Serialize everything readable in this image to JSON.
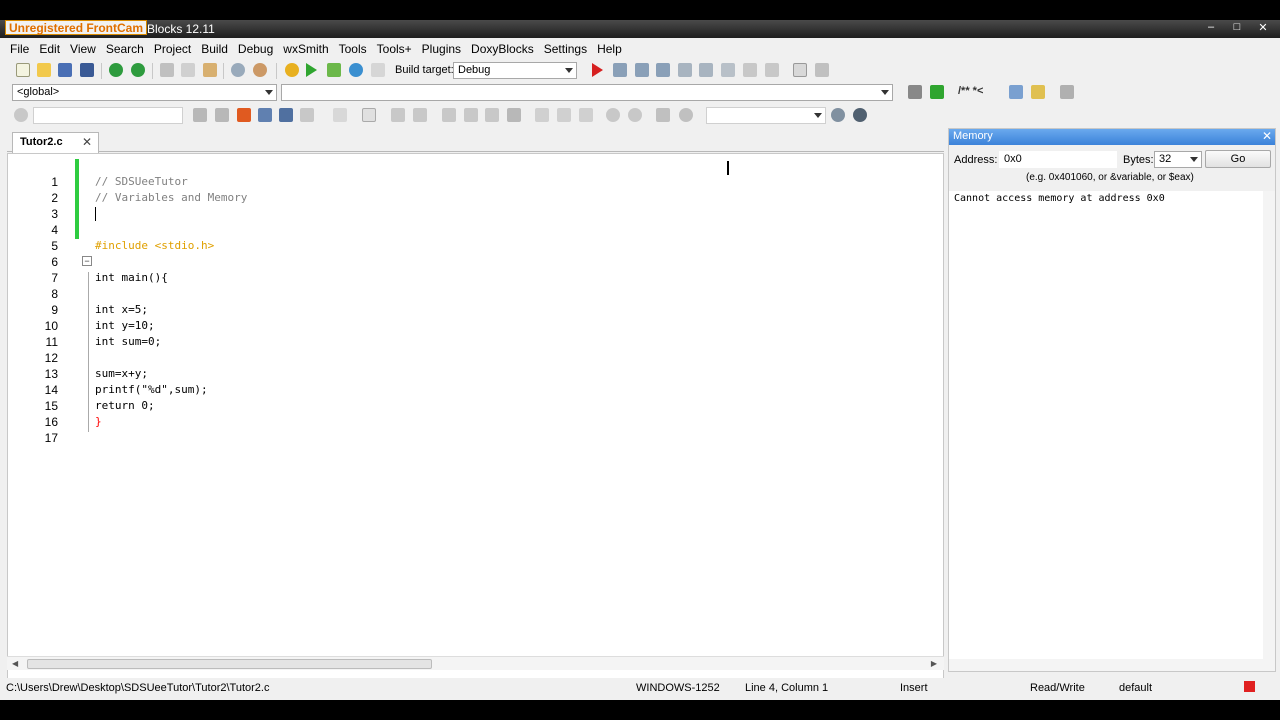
{
  "watermark": "Unregistered FrontCam",
  "window": {
    "title": "Blocks 12.11"
  },
  "menu": [
    "File",
    "Edit",
    "View",
    "Search",
    "Project",
    "Build",
    "Debug",
    "wxSmith",
    "Tools",
    "Tools+",
    "Plugins",
    "DoxyBlocks",
    "Settings",
    "Help"
  ],
  "toolbar": {
    "build_target_label": "Build target:",
    "build_target_value": "Debug",
    "scope_value": "<global>",
    "function_value": "",
    "search_value": ""
  },
  "editor": {
    "tab_label": "Tutor2.c",
    "lines": [
      {
        "n": "1",
        "text": "// SDSUeeTutor"
      },
      {
        "n": "2",
        "text": "// Variables and Memory"
      },
      {
        "n": "3",
        "text": ""
      },
      {
        "n": "4",
        "text": ""
      },
      {
        "n": "5",
        "text": "#include <stdio.h>"
      },
      {
        "n": "6",
        "text": ""
      },
      {
        "n": "7",
        "text": "int main(){"
      },
      {
        "n": "8",
        "text": ""
      },
      {
        "n": "9",
        "text": "int x=5;"
      },
      {
        "n": "10",
        "text": "int y=10;"
      },
      {
        "n": "11",
        "text": "int sum=0;"
      },
      {
        "n": "12",
        "text": ""
      },
      {
        "n": "13",
        "text": "sum=x+y;"
      },
      {
        "n": "14",
        "text": "printf(\"%d\",sum);"
      },
      {
        "n": "15",
        "text": "return 0;"
      },
      {
        "n": "16",
        "text": "}"
      },
      {
        "n": "17",
        "text": ""
      }
    ]
  },
  "memory": {
    "title": "Memory",
    "address_label": "Address:",
    "address_value": "0x0",
    "bytes_label": "Bytes:",
    "bytes_value": "32",
    "go_label": "Go",
    "hint": "(e.g. 0x401060, or &variable, or $eax)",
    "output": "Cannot access memory at address 0x0"
  },
  "status": {
    "path": "C:\\Users\\Drew\\Desktop\\SDSUeeTutor\\Tutor2\\Tutor2.c",
    "encoding": "WINDOWS-1252",
    "position": "Line 4, Column 1",
    "mode": "Insert",
    "access": "Read/Write",
    "lang": "default"
  }
}
